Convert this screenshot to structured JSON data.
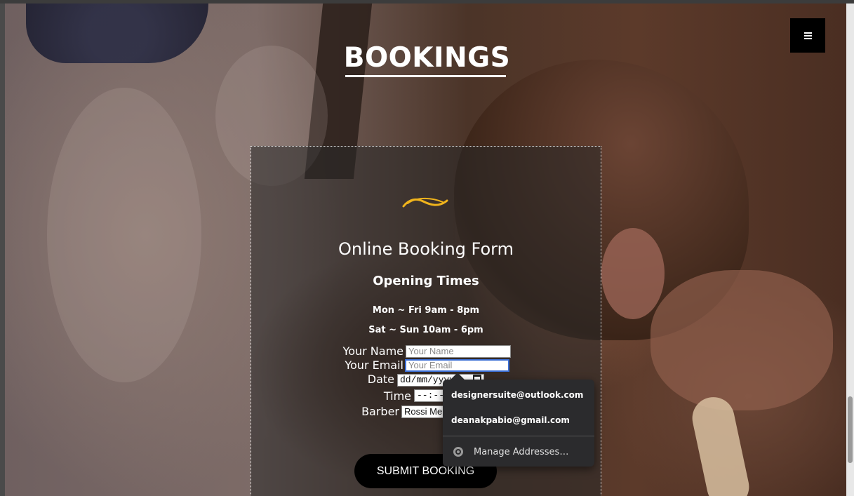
{
  "header": {
    "title": "BOOKINGS",
    "menu_icon": "hamburger-menu-icon"
  },
  "form": {
    "decoration_icon": "flourish-ornament-icon",
    "title": "Online Booking Form",
    "opening_times_title": "Opening Times",
    "hours_weekday": "Mon ~ Fri 9am - 8pm",
    "hours_weekend": "Sat ~ Sun 10am - 6pm",
    "fields": {
      "name": {
        "label": "Your Name",
        "placeholder": "Your Name"
      },
      "email": {
        "label": "Your Email",
        "placeholder": "Your Email"
      },
      "date": {
        "label": "Date",
        "value": "dd/mm/yyyy"
      },
      "time": {
        "label": "Time",
        "value": "--:--"
      },
      "barber": {
        "label": "Barber",
        "selected": "Rossi Me"
      }
    },
    "submit_label": "SUBMIT BOOKING"
  },
  "autofill": {
    "suggestions": [
      "designersuite@outlook.com",
      "deanakpabio@gmail.com"
    ],
    "manage_label": "Manage Addresses…",
    "manage_icon": "chrome-icon"
  },
  "colors": {
    "accent": "#f0b41c",
    "focus_border": "#3b6fd6",
    "button_bg": "#000000",
    "popup_bg": "#2b2b2d"
  }
}
